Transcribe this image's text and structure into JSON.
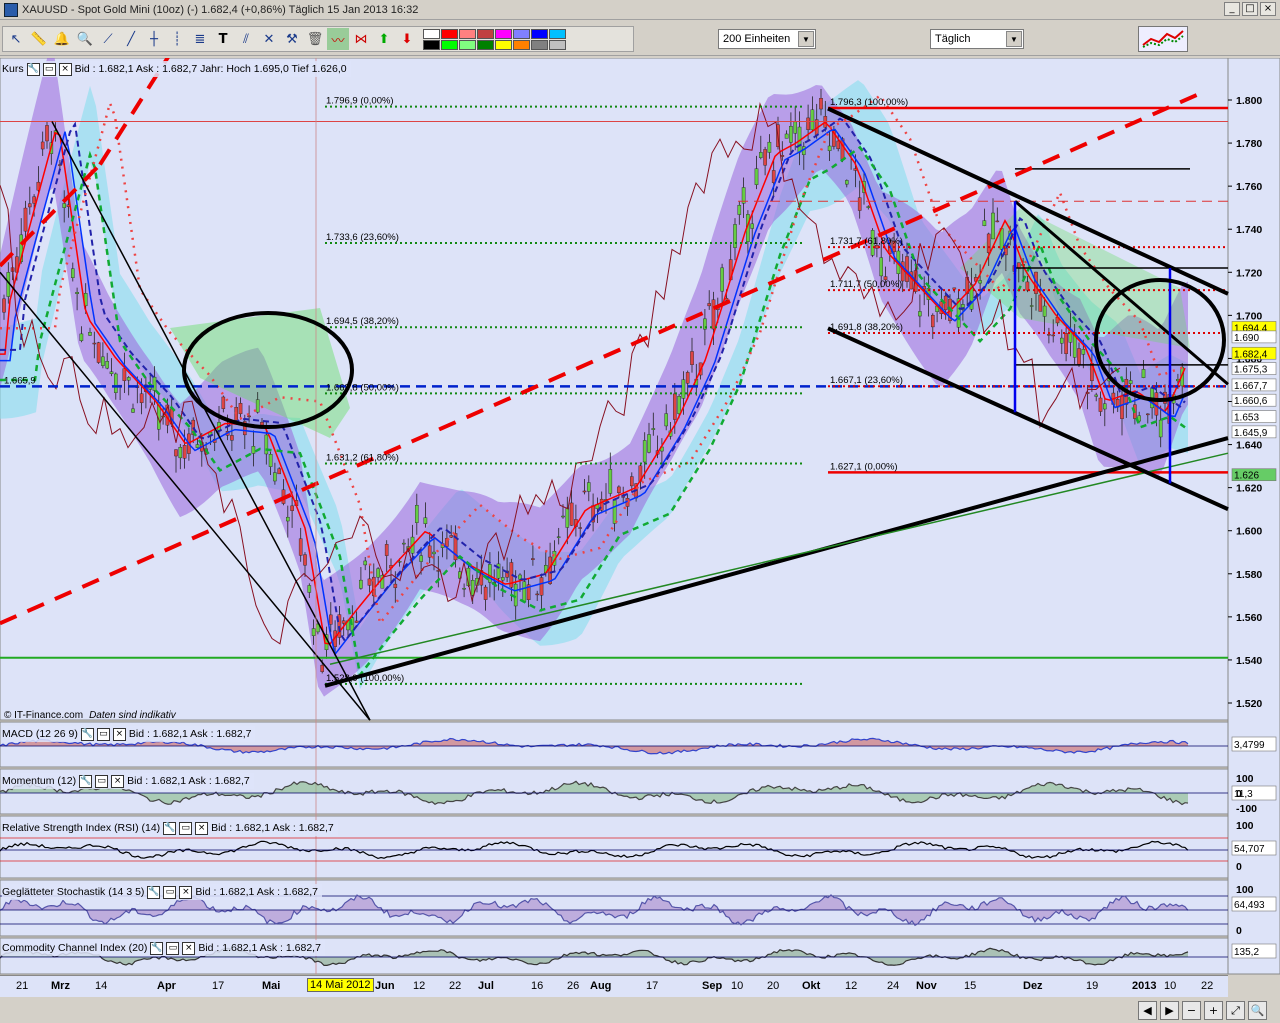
{
  "window": {
    "title": "XAUUSD - Spot Gold Mini (10oz) (-)   1.682,4 (+0,86%)   Täglich  15 Jan 2013 16:32",
    "buttons": [
      "_",
      "□",
      "×"
    ]
  },
  "toolbar": {
    "units_select": "200 Einheiten",
    "period_select": "Täglich",
    "colors": [
      "#ffffff",
      "#ff0000",
      "#ff8080",
      "#c04040",
      "#ff00ff",
      "#8080ff",
      "#0000ff",
      "#00c0ff",
      "#000000",
      "#00ff00",
      "#80ff80",
      "#008000",
      "#ffff00",
      "#ff8000",
      "#808080",
      "#c0c0c0"
    ]
  },
  "main_pane": {
    "label": "Kurs",
    "info": "Bid : 1.682,1  Ask : 1.682,7  Jahr: Hoch 1.695,0  Tief 1.626,0",
    "copyright": "© IT-Finance.com",
    "note": "Daten sind indikativ",
    "y_ticks": [
      "1.800",
      "1.780",
      "1.760",
      "1.740",
      "1.720",
      "1.700",
      "1.680",
      "1.660",
      "1.640",
      "1.620",
      "1.600",
      "1.580",
      "1.560",
      "1.540",
      "1.520"
    ],
    "price_tags": [
      {
        "text": "1.694,4",
        "color": "#ffff00",
        "value": 1694.4
      },
      {
        "text": "1.690",
        "color": "#ffffff",
        "value": 1690
      },
      {
        "text": "1.682,4",
        "color": "#ffff00",
        "value": 1682.4
      },
      {
        "text": "1.675,3",
        "color": "#ffffff",
        "value": 1675.3
      },
      {
        "text": "1.667,7",
        "color": "#ffffff",
        "value": 1667.7
      },
      {
        "text": "1.660,6",
        "color": "#ffffff",
        "value": 1660.6
      },
      {
        "text": "1.653",
        "color": "#ffffff",
        "value": 1653
      },
      {
        "text": "1.645,9",
        "color": "#ffffff",
        "value": 1645.9
      },
      {
        "text": "1.626",
        "color": "#66cc66",
        "value": 1626
      }
    ],
    "fib_left": [
      {
        "text": "1.796,9 (0,00%)",
        "value": 1796.9
      },
      {
        "text": "1.733,6 (23,60%)",
        "value": 1733.6
      },
      {
        "text": "1.694,5 (38,20%)",
        "value": 1694.5
      },
      {
        "text": "1.663,8 (50,00%)",
        "value": 1663.8
      },
      {
        "text": "1.631,2 (61,80%)",
        "value": 1631.2
      },
      {
        "text": "1.528,9 (100,00%)",
        "value": 1528.9
      }
    ],
    "fib_right": [
      {
        "text": "1.796,3 (100,00%)",
        "value": 1796.3
      },
      {
        "text": "1.731,7 (61,80%)",
        "value": 1731.7
      },
      {
        "text": "1.711,7 (50,00%)",
        "value": 1711.7
      },
      {
        "text": "1.691,8 (38,20%)",
        "value": 1691.8
      },
      {
        "text": "1.667,1 (23,60%)",
        "value": 1667.1
      },
      {
        "text": "1.627,1 (0,00%)",
        "value": 1627.1
      }
    ],
    "left_level": "1.665,9"
  },
  "indicators": [
    {
      "label": "MACD (12 26 9)",
      "info": "Bid : 1.682,1  Ask : 1.682,7",
      "ticks": [],
      "value": "3,4799"
    },
    {
      "label": "Momentum (12)",
      "info": "Bid : 1.682,1  Ask : 1.682,7",
      "ticks": [
        "100",
        "0",
        "-100"
      ],
      "value": "11,3"
    },
    {
      "label": "Relative Strength Index (RSI) (14)",
      "info": "Bid : 1.682,1  Ask : 1.682,7",
      "ticks": [
        "100",
        "0"
      ],
      "value": "54,707"
    },
    {
      "label": "Geglätteter Stochastik (14 3 5)",
      "info": "Bid : 1.682,1  Ask : 1.682,7",
      "ticks": [
        "100",
        "0"
      ],
      "value": "64,493"
    },
    {
      "label": "Commodity Channel Index (20)",
      "info": "Bid : 1.682,1  Ask : 1.682,7",
      "ticks": [],
      "value": "135,2"
    }
  ],
  "x_axis": {
    "labels": [
      "21",
      "Mrz",
      "14",
      "Apr",
      "17",
      "Mai",
      "14 Mai 2012",
      "Jun",
      "12",
      "22",
      "Jul",
      "16",
      "26",
      "Aug",
      "17",
      "Sep",
      "10",
      "20",
      "Okt",
      "12",
      "24",
      "Nov",
      "15",
      "Dez",
      "19",
      "2013",
      "10",
      "22"
    ],
    "bold": [
      "Mrz",
      "Apr",
      "Mai",
      "Jun",
      "Jul",
      "Aug",
      "Sep",
      "Okt",
      "Nov",
      "Dez",
      "2013"
    ],
    "highlight": "14 Mai 2012"
  }
}
